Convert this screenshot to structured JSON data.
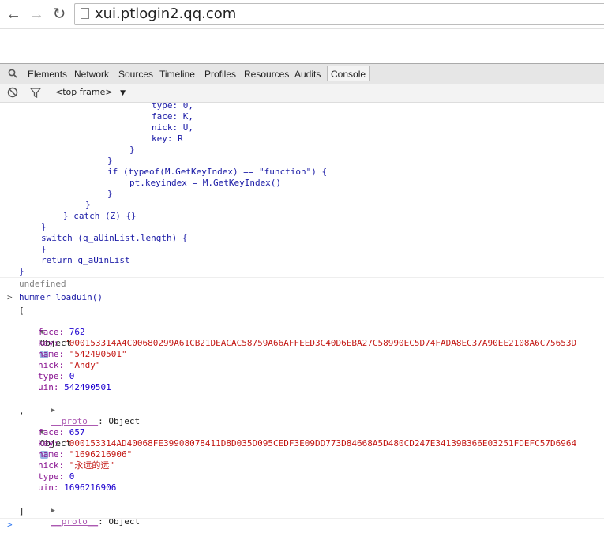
{
  "browser": {
    "url": "xui.ptlogin2.qq.com"
  },
  "devtools": {
    "tabs": [
      "Elements",
      "Network",
      "Sources",
      "Timeline",
      "Profiles",
      "Resources",
      "Audits",
      "Console"
    ],
    "active_tab": "Console",
    "frame_selector": "<top frame>"
  },
  "console": {
    "code_lines": [
      "type: 0,",
      "face: K,",
      "nick: U,",
      "key: R",
      "}",
      "}",
      "if (typeof(M.GetKeyIndex) == \"function\") {",
      "pt.keyindex = M.GetKeyIndex()",
      "}",
      "}",
      "} catch (Z) {}",
      "}",
      "switch (q_aUinList.length) {",
      "}",
      "return q_aUinList",
      "}"
    ],
    "undefined_text": "undefined",
    "command": "hummer_loaduin()",
    "open_bracket": "[",
    "close_bracket": "]",
    "comma": ",",
    "objects": [
      {
        "label": "Object",
        "face": "762",
        "key": "\"000153314A4C00680299A61CB21DEACAC58759A66AFFEED3C40D6EBA27C58990EC5D74FADA8EC37A90EE2108A6C75653D",
        "name": "\"542490501\"",
        "nick": "\"Andy\"",
        "type": "0",
        "uin": "542490501",
        "proto": "__proto__",
        "proto_value": "Object"
      },
      {
        "label": "Object",
        "face": "657",
        "key": "\"000153314AD40068FE39908078411D8D035D095CEDF3E09DD773D84668A5D480CD247E34139B366E03251FDEFC57D6964",
        "name": "\"1696216906\"",
        "nick": "\"永远的远\"",
        "type": "0",
        "uin": "1696216906",
        "proto": "__proto__",
        "proto_value": "Object"
      }
    ],
    "keys": {
      "face": "face:",
      "key": "key:",
      "name": "name:",
      "nick": "nick:",
      "type": "type:",
      "uin": "uin:"
    },
    "prompt": ">"
  }
}
